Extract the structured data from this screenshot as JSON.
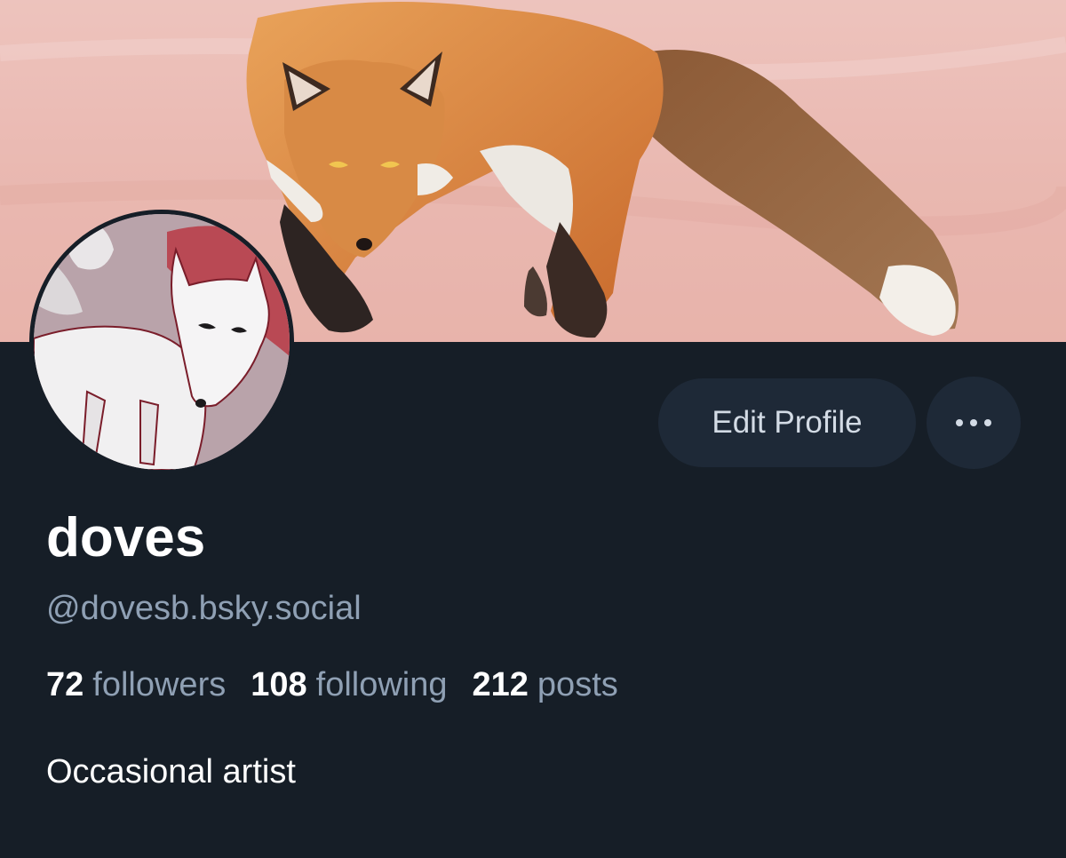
{
  "profile": {
    "display_name": "doves",
    "handle": "@dovesb.bsky.social",
    "bio": "Occasional artist",
    "banner_image": "red fox illustration on pink background",
    "avatar_image": "white fox illustration on red background"
  },
  "stats": {
    "followers_count": "72",
    "followers_label": "followers",
    "following_count": "108",
    "following_label": "following",
    "posts_count": "212",
    "posts_label": "posts"
  },
  "actions": {
    "edit_profile_label": "Edit Profile",
    "more_icon": "more-horizontal-icon"
  },
  "colors": {
    "background": "#161e27",
    "button_bg": "#1e2937",
    "muted_text": "#8fa0b4",
    "button_text": "#d3dbe5"
  }
}
